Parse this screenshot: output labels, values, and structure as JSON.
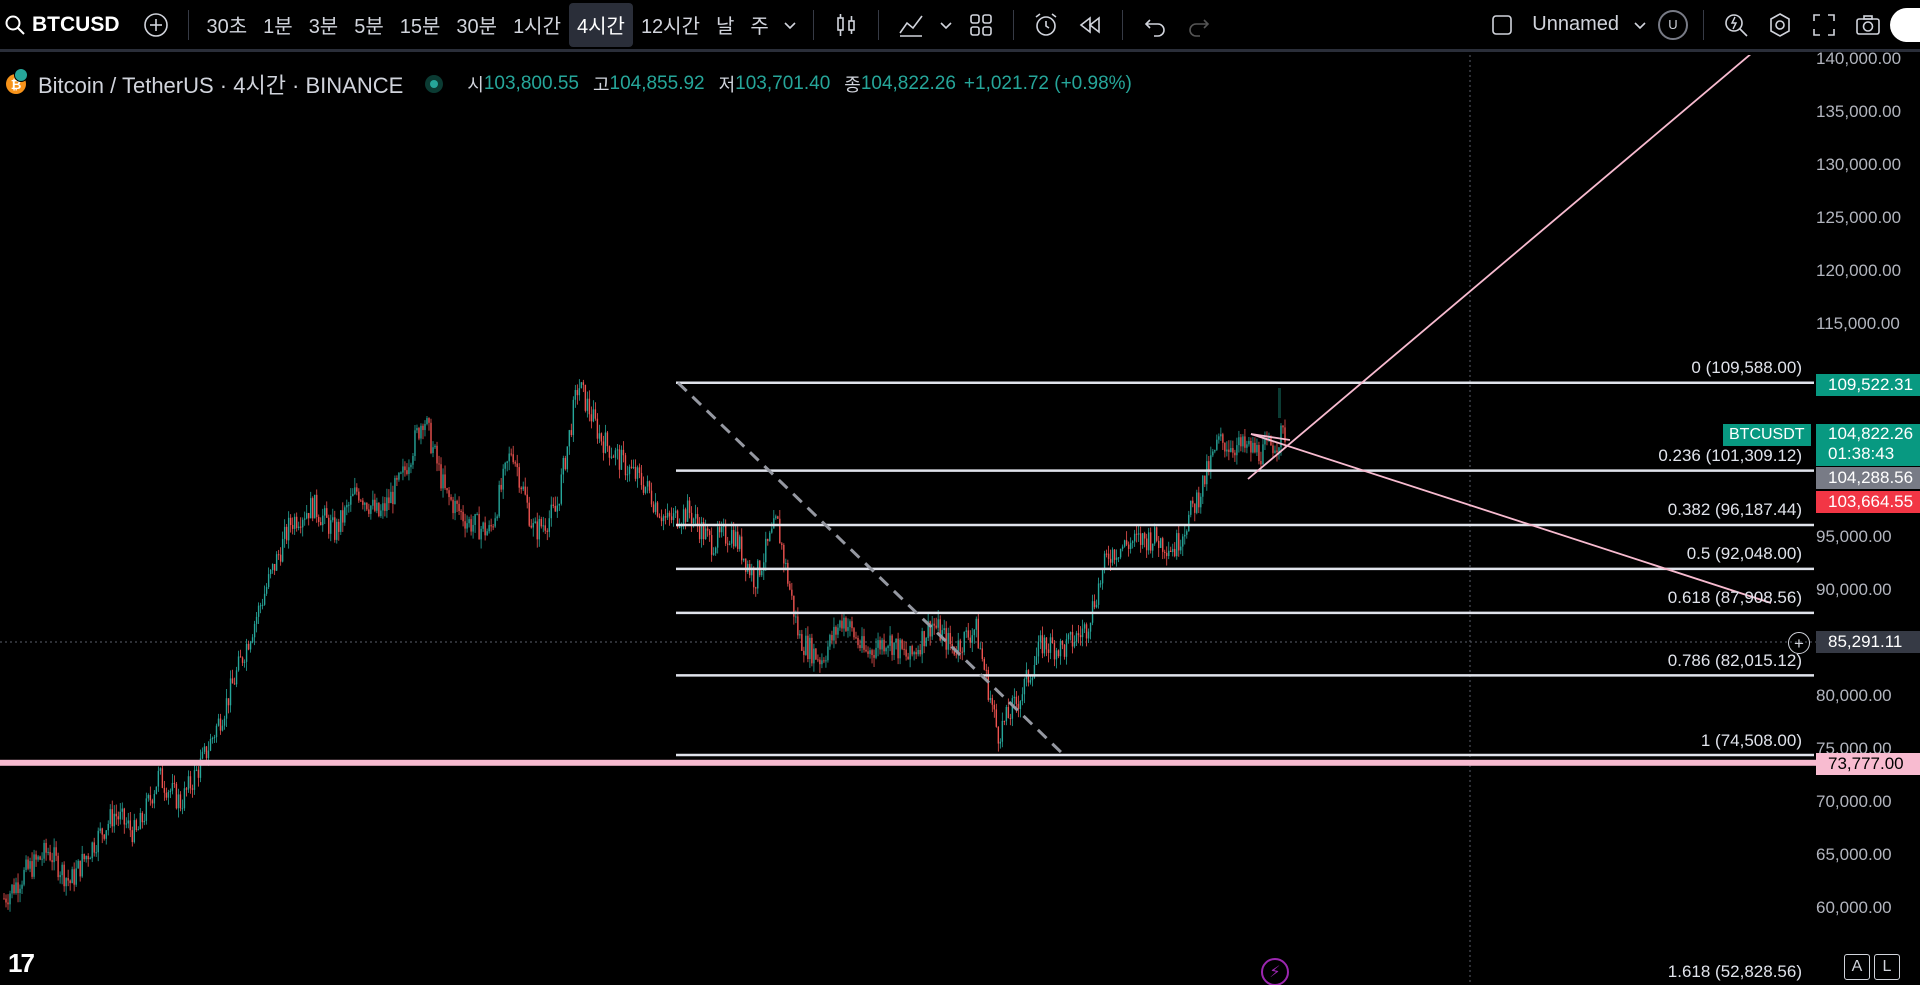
{
  "toolbar": {
    "symbol": "BTCUSD",
    "timeframes": [
      "30초",
      "1분",
      "3분",
      "5분",
      "15분",
      "30분",
      "1시간",
      "4시간",
      "12시간",
      "날",
      "주"
    ],
    "active_timeframe": "4시간",
    "layout_name": "Unnamed",
    "avatar_letter": "U"
  },
  "legend": {
    "title": "Bitcoin / TetherUS · 4시간 · BINANCE",
    "open_label": "시",
    "open": "103,800.55",
    "high_label": "고",
    "high": "104,855.92",
    "low_label": "저",
    "low": "103,701.40",
    "close_label": "종",
    "close": "104,822.26",
    "change": "+1,021.72 (+0.98%)"
  },
  "price_axis": {
    "ticks": [
      "140,000.00",
      "135,000.00",
      "130,000.00",
      "125,000.00",
      "120,000.00",
      "115,000.00",
      "95,000.00",
      "90,000.00",
      "80,000.00",
      "75,000.00",
      "70,000.00",
      "65,000.00",
      "60,000.00"
    ],
    "tag_high": "109,522.31",
    "tag_current_price": "104,822.26",
    "tag_current_countdown": "01:38:43",
    "tag_symbol": "BTCUSDT",
    "tag_gray": "104,288.56",
    "tag_red": "103,664.55",
    "tag_crosshair": "85,291.11",
    "tag_pink": "73,777.00"
  },
  "fib": {
    "levels": [
      {
        "ratio": "0",
        "price": 109588.0,
        "label": "0 (109,588.00)"
      },
      {
        "ratio": "0.236",
        "price": 101309.12,
        "label": "0.236 (101,309.12)"
      },
      {
        "ratio": "0.382",
        "price": 96187.44,
        "label": "0.382 (96,187.44)"
      },
      {
        "ratio": "0.5",
        "price": 92048.0,
        "label": "0.5 (92,048.00)"
      },
      {
        "ratio": "0.618",
        "price": 87908.56,
        "label": "0.618 (87,908.56)"
      },
      {
        "ratio": "0.786",
        "price": 82015.12,
        "label": "0.786 (82,015.12)"
      },
      {
        "ratio": "1",
        "price": 74508.0,
        "label": "1 (74,508.00)"
      },
      {
        "ratio": "1.618",
        "price": 52828.56,
        "label": "1.618 (52,828.56)"
      }
    ]
  },
  "horizontal_line": {
    "price": 73777.0,
    "color": "#f8bbd0"
  },
  "colors": {
    "up": "#26a69a",
    "down": "#ef5350",
    "background": "#000000",
    "fib_line": "#e0e3eb",
    "trend_line": "#f8bbd0"
  },
  "chart_data": {
    "type": "candlestick",
    "symbol": "BTCUSDT",
    "timeframe": "4시간",
    "ylim": [
      52000,
      141000
    ],
    "close_path": [
      61000,
      63500,
      65500,
      62500,
      66000,
      69000,
      67000,
      72500,
      70000,
      74000,
      79000,
      85000,
      91000,
      96500,
      98000,
      95500,
      99500,
      97000,
      100500,
      106500,
      99000,
      96500,
      95500,
      103500,
      95500,
      97500,
      109500,
      104500,
      102000,
      100000,
      96500,
      97500,
      94500,
      95500,
      91000,
      96500,
      85500,
      83500,
      87500,
      84000,
      85500,
      83500,
      87000,
      84500,
      86500,
      76500,
      80000,
      85000,
      84500,
      86500,
      93500,
      94500,
      95000,
      94000,
      98500,
      104000,
      103500,
      103000,
      104822
    ],
    "y_range_shown": [
      55000,
      140000
    ]
  }
}
